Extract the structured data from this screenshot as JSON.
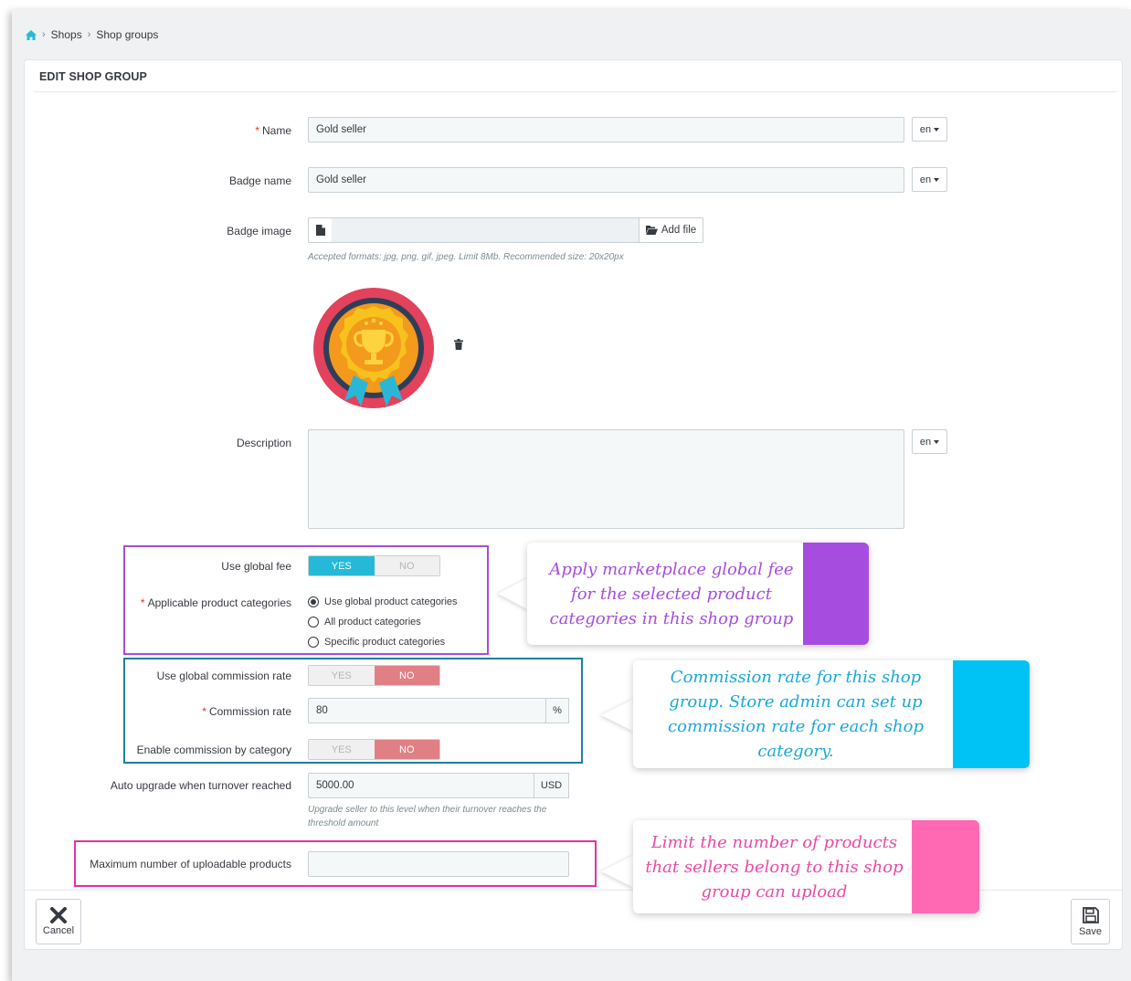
{
  "breadcrumb": {
    "items": [
      "Shops",
      "Shop groups"
    ]
  },
  "panel": {
    "title": "EDIT SHOP GROUP"
  },
  "form": {
    "name": {
      "label": "Name",
      "value": "Gold seller",
      "lang": "en"
    },
    "badge_name": {
      "label": "Badge name",
      "value": "Gold seller",
      "lang": "en"
    },
    "badge_image": {
      "label": "Badge image",
      "button": "Add file",
      "help": "Accepted formats: jpg, png, gif, jpeg. Limit 8Mb. Recommended size: 20x20px"
    },
    "description": {
      "label": "Description",
      "value": "",
      "lang": "en"
    },
    "use_global_fee": {
      "label": "Use global fee",
      "yes": "YES",
      "no": "NO",
      "selected": "YES"
    },
    "applicable_categories": {
      "label": "Applicable product categories",
      "options": [
        "Use global product categories",
        "All product categories",
        "Specific product categories"
      ],
      "selected": "Use global product categories"
    },
    "use_global_commission": {
      "label": "Use global commission rate",
      "yes": "YES",
      "no": "NO",
      "selected": "NO"
    },
    "commission_rate": {
      "label": "Commission rate",
      "value": "80",
      "suffix": "%"
    },
    "commission_by_category": {
      "label": "Enable commission by category",
      "yes": "YES",
      "no": "NO",
      "selected": "NO"
    },
    "auto_upgrade": {
      "label": "Auto upgrade when turnover reached",
      "value": "5000.00",
      "suffix": "USD",
      "help": "Upgrade seller to this level when their turnover reaches the threshold amount"
    },
    "max_products": {
      "label": "Maximum number of uploadable products",
      "value": ""
    }
  },
  "footer": {
    "cancel": "Cancel",
    "save": "Save"
  },
  "callouts": {
    "fee": {
      "text": "Apply marketplace global fee for the selected product categories in this shop group",
      "color": "#a64de0"
    },
    "commission": {
      "text": "Commission rate for this shop group. Store admin can set up commission rate for each shop category.",
      "color": "#00c3f5"
    },
    "limit": {
      "text": "Limit the number of products that sellers belong to this shop group can upload",
      "color": "#ff69b4"
    }
  },
  "colors": {
    "accent": "#25b9d7",
    "no_active": "#e08085",
    "required": "#e52e2e"
  }
}
